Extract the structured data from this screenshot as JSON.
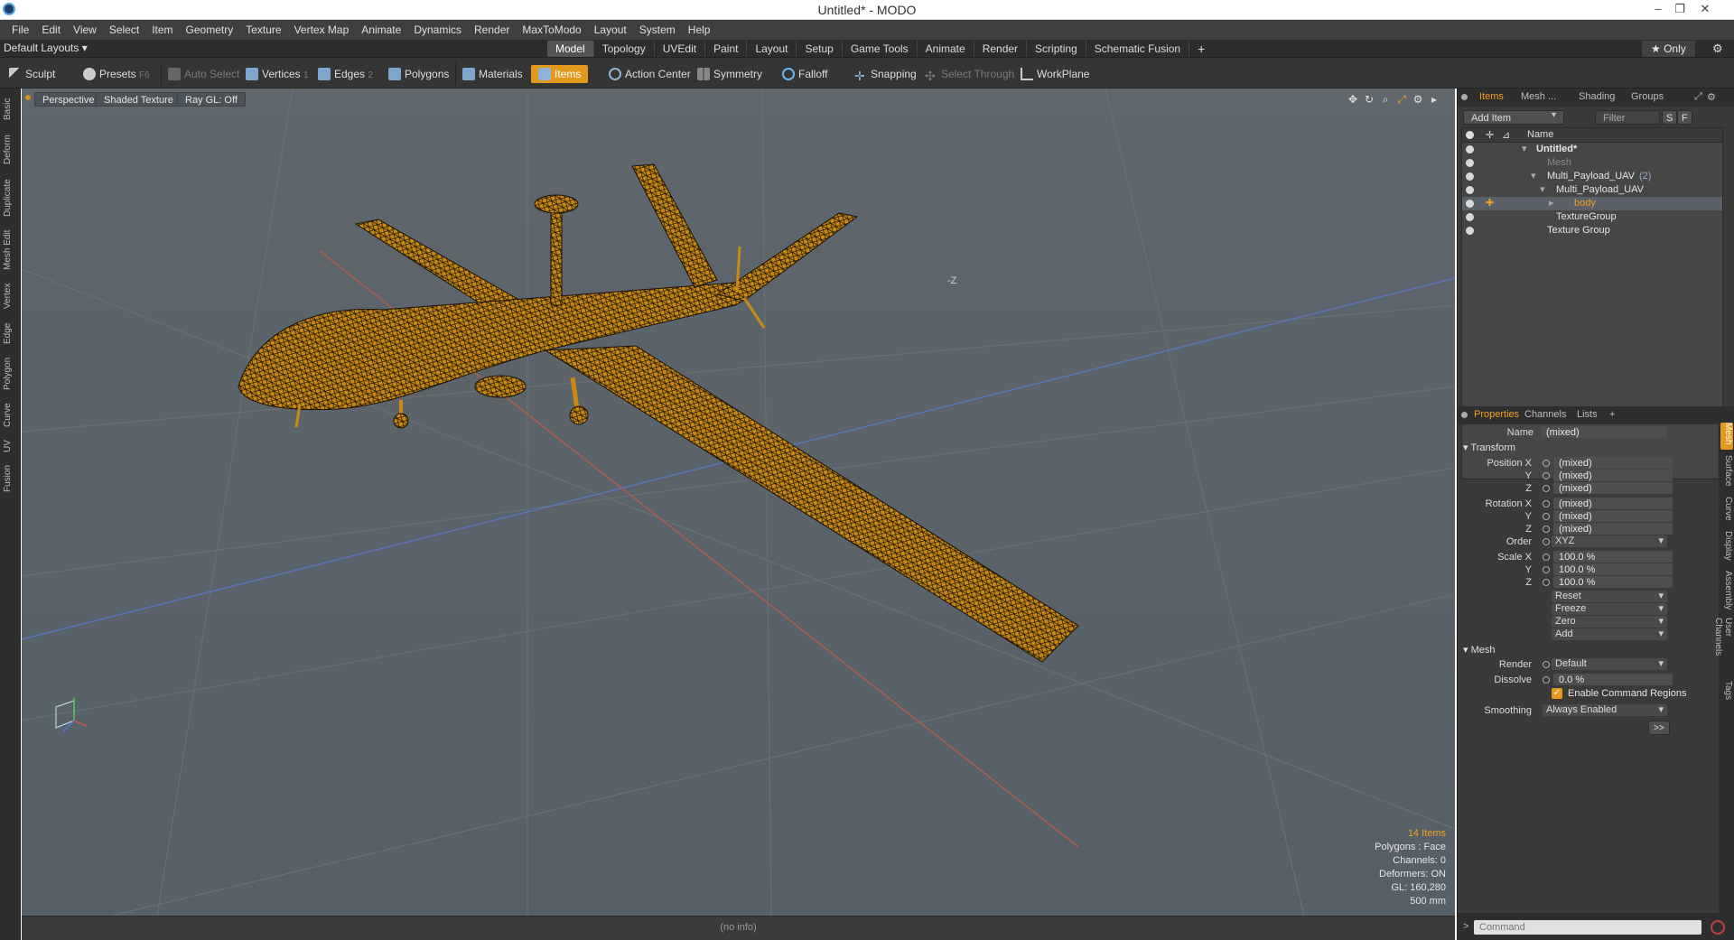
{
  "window": {
    "title": "Untitled* - MODO"
  },
  "menu": [
    "File",
    "Edit",
    "View",
    "Select",
    "Item",
    "Geometry",
    "Texture",
    "Vertex Map",
    "Animate",
    "Dynamics",
    "Render",
    "MaxToModo",
    "Layout",
    "System",
    "Help"
  ],
  "layout": {
    "dropdown": "Default Layouts ▾",
    "tabs": [
      "Model",
      "Topology",
      "UVEdit",
      "Paint",
      "Layout",
      "Setup",
      "Game Tools",
      "Animate",
      "Render",
      "Scripting",
      "Schematic Fusion"
    ],
    "active_tab": "Model",
    "only_label": "★ Only"
  },
  "toolbar": {
    "sculpt": "Sculpt",
    "presets": "Presets",
    "presets_key": "F6",
    "auto_select": "Auto Select",
    "vertices": "Vertices",
    "vertices_key": "1",
    "edges": "Edges",
    "edges_key": "2",
    "polygons": "Polygons",
    "materials": "Materials",
    "items": "Items",
    "action_center": "Action Center",
    "symmetry": "Symmetry",
    "falloff": "Falloff",
    "snapping": "Snapping",
    "select_through": "Select Through",
    "workplane": "WorkPlane"
  },
  "left_tabs": [
    "Basic",
    "Deform",
    "Duplicate",
    "Mesh Edit",
    "Vertex",
    "Edge",
    "Polygon",
    "Curve",
    "UV",
    "Fusion"
  ],
  "viewport": {
    "perspective": "Perspective",
    "shading": "Shaded Texture",
    "raygl": "Ray GL: Off",
    "stats": {
      "items": "14 Items",
      "polygons": "Polygons : Face",
      "channels": "Channels: 0",
      "deformers": "Deformers: ON",
      "gl": "GL: 160,280",
      "scale": "500 mm"
    },
    "info": "(no info)",
    "axis_label": "-Z",
    "model_color": "#f0a020"
  },
  "items_panel": {
    "tabs": [
      "Items",
      "Mesh ...",
      "Shading",
      "Groups"
    ],
    "add_item": "Add Item",
    "filter": "Filter Items",
    "s_btn": "S",
    "f_btn": "F",
    "col_name": "Name",
    "rows": [
      {
        "label": "Untitled*",
        "indent": 0
      },
      {
        "label": "Mesh",
        "indent": 1
      },
      {
        "label": "Multi_Payload_UAV",
        "suffix": "(2)",
        "indent": 1
      },
      {
        "label": "Multi_Payload_UAV",
        "indent": 2
      },
      {
        "label": "body",
        "indent": 3
      },
      {
        "label": "TextureGroup",
        "indent": 2
      },
      {
        "label": "Texture Group",
        "indent": 1
      }
    ]
  },
  "properties": {
    "tabs": [
      "Properties",
      "Channels",
      "Lists",
      "+"
    ],
    "name_label": "Name",
    "name_value": "(mixed)",
    "transform": "Transform",
    "position_x": "Position X",
    "rotation_x": "Rotation X",
    "scale_x": "Scale X",
    "y": "Y",
    "z": "Z",
    "mixed": "(mixed)",
    "order_label": "Order",
    "order_value": "XYZ",
    "scale_value": "100.0 %",
    "reset": "Reset",
    "freeze": "Freeze",
    "zero": "Zero",
    "add": "Add",
    "mesh": "Mesh",
    "render_label": "Render",
    "render_value": "Default",
    "dissolve_label": "Dissolve",
    "dissolve_value": "0.0 %",
    "enable_cmd_regions": "Enable Command Regions",
    "smoothing_label": "Smoothing",
    "smoothing_value": "Always Enabled",
    "more": ">>"
  },
  "right_tabs": [
    "Mesh",
    "Surface",
    "Curve",
    "Display",
    "Assembly",
    "User Channels",
    "Tags"
  ],
  "command": {
    "placeholder": "Command",
    "prompt": ">"
  }
}
